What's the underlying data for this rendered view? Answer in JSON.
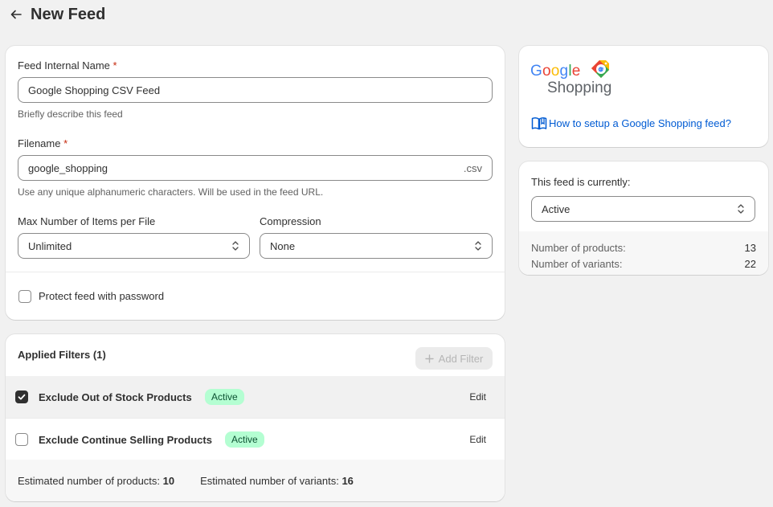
{
  "header": {
    "title": "New Feed"
  },
  "form": {
    "name_label": "Feed Internal Name",
    "required_mark": "*",
    "name_value": "Google Shopping CSV Feed",
    "name_help": "Briefly describe this feed",
    "filename_label": "Filename",
    "filename_value": "google_shopping",
    "filename_suffix": ".csv",
    "filename_help": "Use any unique alphanumeric characters. Will be used in the feed URL.",
    "max_items_label": "Max Number of Items per File",
    "max_items_value": "Unlimited",
    "compression_label": "Compression",
    "compression_value": "None",
    "password_label": "Protect feed with password",
    "password_checked": false
  },
  "filters": {
    "heading": "Applied Filters (1)",
    "add_label": "Add Filter",
    "rows": [
      {
        "name": "Exclude Out of Stock Products",
        "badge": "Active",
        "edit": "Edit",
        "checked": true
      },
      {
        "name": "Exclude Continue Selling Products",
        "badge": "Active",
        "edit": "Edit",
        "checked": false
      }
    ],
    "est_products_label": "Estimated number of products:",
    "est_products_value": "10",
    "est_variants_label": "Estimated number of variants:",
    "est_variants_value": "16"
  },
  "google": {
    "logo_word": "Google",
    "logo_sub": "Shopping",
    "link_text": "How to setup a Google Shopping feed?"
  },
  "status": {
    "label": "This feed is currently:",
    "value": "Active",
    "products_label": "Number of products:",
    "products_value": "13",
    "variants_label": "Number of variants:",
    "variants_value": "22"
  },
  "colors": {
    "link": "#005bd3",
    "badge_bg": "#b4fed2",
    "required": "#c5280c"
  }
}
